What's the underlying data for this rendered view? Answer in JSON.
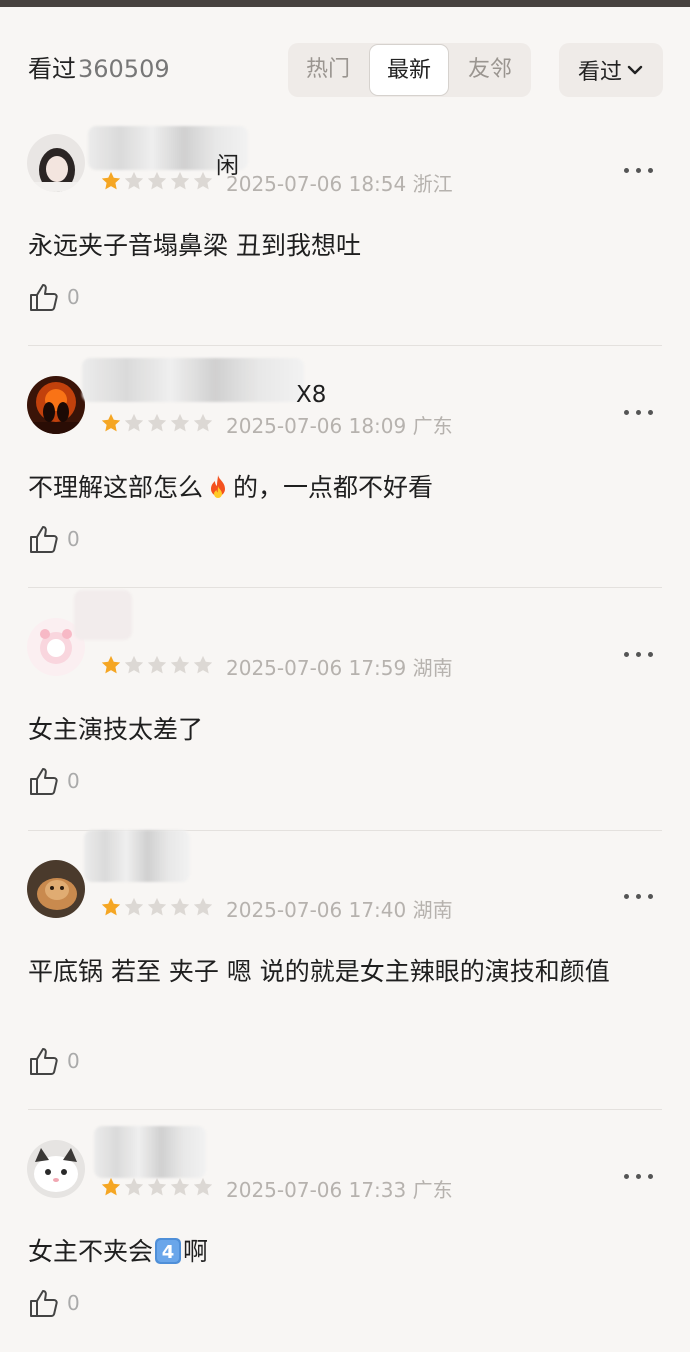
{
  "header": {
    "count_label": "看过",
    "count_value": "360509",
    "tabs": [
      {
        "label": "热门"
      },
      {
        "label": "最新"
      },
      {
        "label": "友邻"
      }
    ],
    "filter_label": "看过"
  },
  "reviews": [
    {
      "name_visible": "闲",
      "rating": 1,
      "max_rating": 5,
      "date": "2025-07-06 18:54",
      "location": "浙江",
      "text": "永远夹子音塌鼻梁 丑到我想吐",
      "likes": "0"
    },
    {
      "name_visible": "X8",
      "rating": 1,
      "max_rating": 5,
      "date": "2025-07-06 18:09",
      "location": "广东",
      "text_before": "不理解这部怎么",
      "text_after": "的，一点都不好看",
      "emoji": "fire-emoji",
      "likes": "0"
    },
    {
      "name_visible": "",
      "rating": 1,
      "max_rating": 5,
      "date": "2025-07-06 17:59",
      "location": "湖南",
      "text": "女主演技太差了",
      "likes": "0"
    },
    {
      "name_visible": "",
      "rating": 1,
      "max_rating": 5,
      "date": "2025-07-06 17:40",
      "location": "湖南",
      "text": "平底锅 若至 夹子 嗯 说的就是女主辣眼的演技和颜值",
      "likes": "0"
    },
    {
      "name_visible": "",
      "rating": 1,
      "max_rating": 5,
      "date": "2025-07-06 17:33",
      "location": "广东",
      "text_before": "女主不夹会",
      "text_after": "啊",
      "emoji": "keycap-4-emoji",
      "likes": "0"
    }
  ],
  "colors": {
    "star_filled": "#f5a623",
    "star_empty": "#dcd8d4",
    "background": "#f8f6f4",
    "meta_text": "#b6b2ae"
  }
}
